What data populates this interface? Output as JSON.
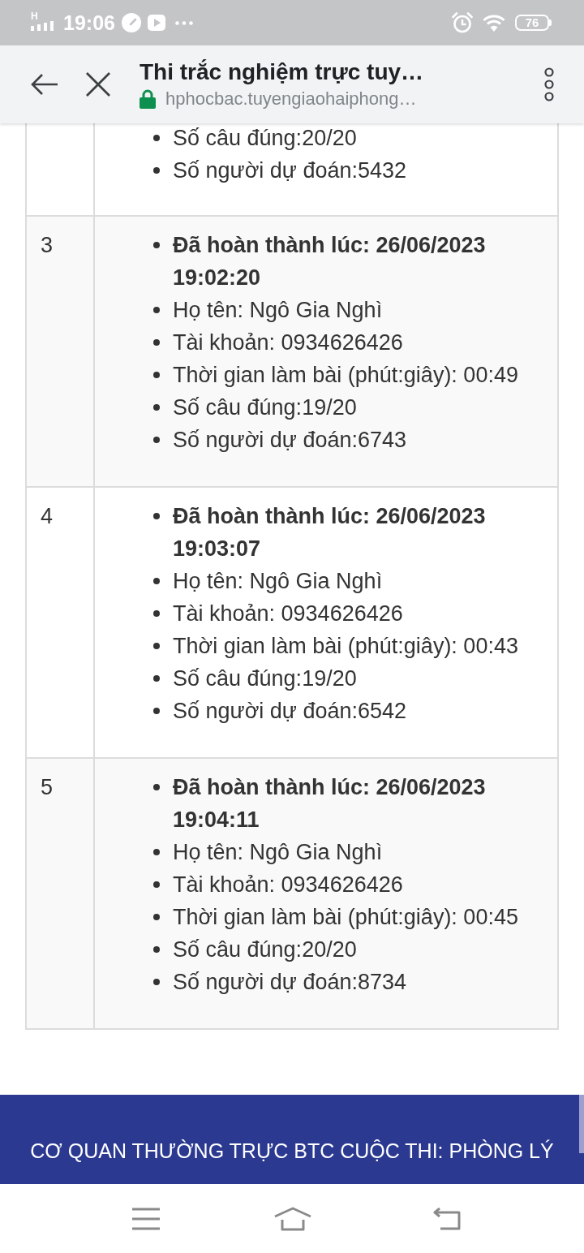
{
  "status_bar": {
    "network": "H",
    "time": "19:06",
    "battery": "76"
  },
  "browser_bar": {
    "title": "Thi trắc nghiệm trực tuy…",
    "url": "hphocbac.tuyengiaohaiphong…",
    "secure": true
  },
  "results": {
    "rows": [
      {
        "items": [
          {
            "kind": "detail",
            "text": "Số câu đúng:20/20"
          },
          {
            "kind": "detail",
            "text": "Số người dự đoán:5432"
          }
        ]
      },
      {
        "number": "3",
        "items": [
          {
            "kind": "timestamp",
            "text": "Đã hoàn thành lúc: 26/06/2023 19:02:20"
          },
          {
            "kind": "detail",
            "text": "Họ tên: Ngô Gia Nghì"
          },
          {
            "kind": "detail",
            "text": "Tài khoản: 0934626426"
          },
          {
            "kind": "detail",
            "text": "Thời gian làm bài (phút:giây): 00:49"
          },
          {
            "kind": "detail",
            "text": "Số câu đúng:19/20"
          },
          {
            "kind": "detail",
            "text": "Số người dự đoán:6743"
          }
        ]
      },
      {
        "number": "4",
        "items": [
          {
            "kind": "timestamp",
            "text": "Đã hoàn thành lúc: 26/06/2023 19:03:07"
          },
          {
            "kind": "detail",
            "text": "Họ tên: Ngô Gia Nghì"
          },
          {
            "kind": "detail",
            "text": "Tài khoản: 0934626426"
          },
          {
            "kind": "detail",
            "text": "Thời gian làm bài (phút:giây): 00:43"
          },
          {
            "kind": "detail",
            "text": "Số câu đúng:19/20"
          },
          {
            "kind": "detail",
            "text": "Số người dự đoán:6542"
          }
        ]
      },
      {
        "number": "5",
        "items": [
          {
            "kind": "timestamp",
            "text": "Đã hoàn thành lúc: 26/06/2023 19:04:11"
          },
          {
            "kind": "detail",
            "text": "Họ tên: Ngô Gia Nghì"
          },
          {
            "kind": "detail",
            "text": "Tài khoản: 0934626426"
          },
          {
            "kind": "detail",
            "text": "Thời gian làm bài (phút:giây): 00:45"
          },
          {
            "kind": "detail",
            "text": "Số câu đúng:20/20"
          },
          {
            "kind": "detail",
            "text": "Số người dự đoán:8734"
          }
        ]
      }
    ]
  },
  "footer": {
    "text": "CƠ QUAN THƯỜNG TRỰC BTC CUỘC THI: PHÒNG LÝ"
  }
}
